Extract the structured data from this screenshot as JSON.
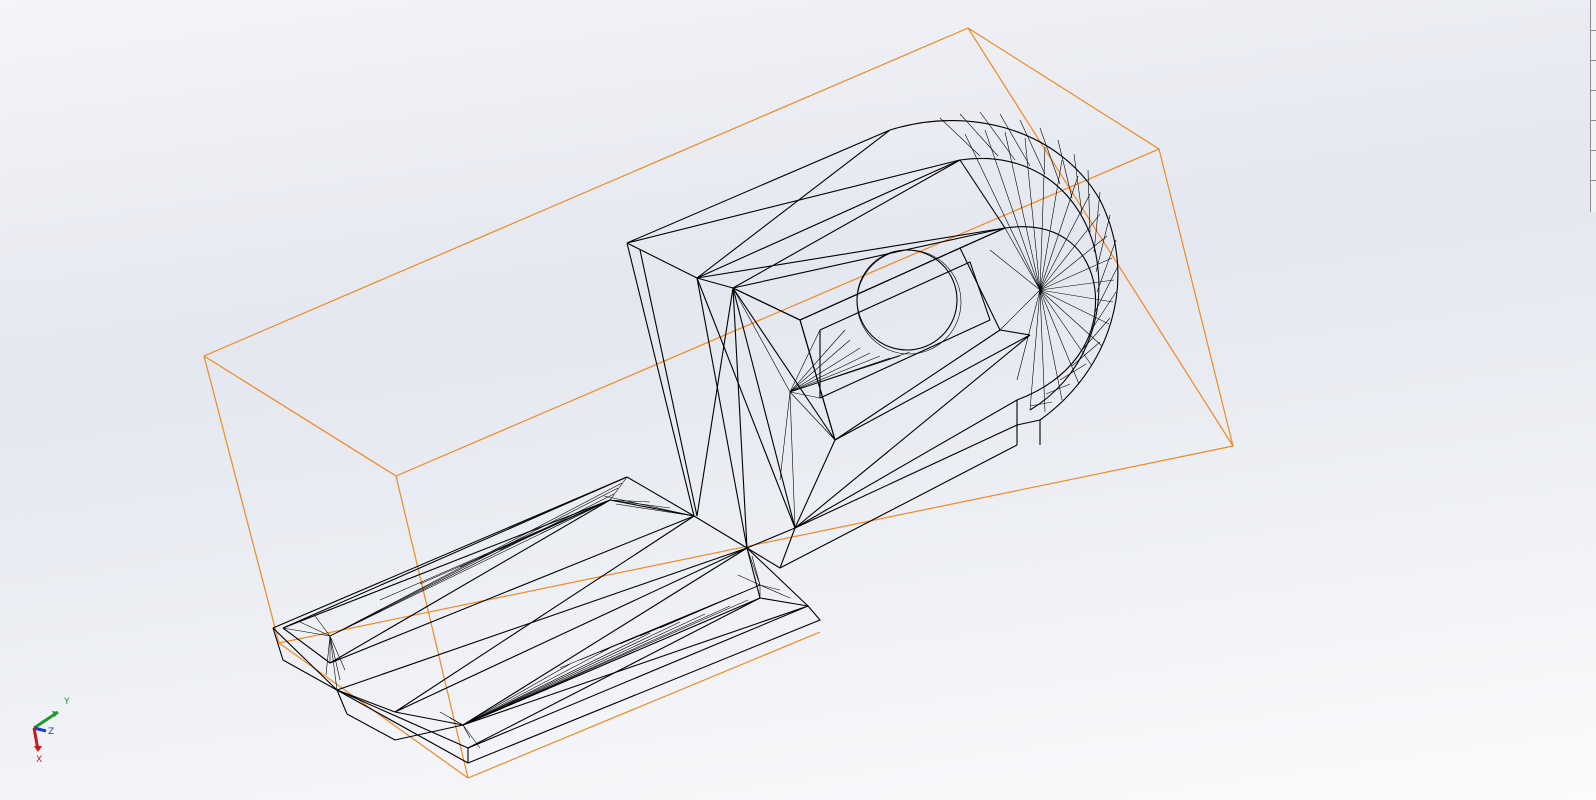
{
  "viewport": {
    "wire_color": "#000000",
    "bbox_color": "#f08a24",
    "background_top": "#f4f5f8",
    "background_mid": "#e4e7ef",
    "background_bottom": "#fbfbfc"
  },
  "triad": {
    "x_label": "X",
    "y_label": "Y",
    "z_label": "Z",
    "x_color": "#c8191e",
    "y_color": "#1f9a2e",
    "z_color": "#1d3ec8"
  }
}
